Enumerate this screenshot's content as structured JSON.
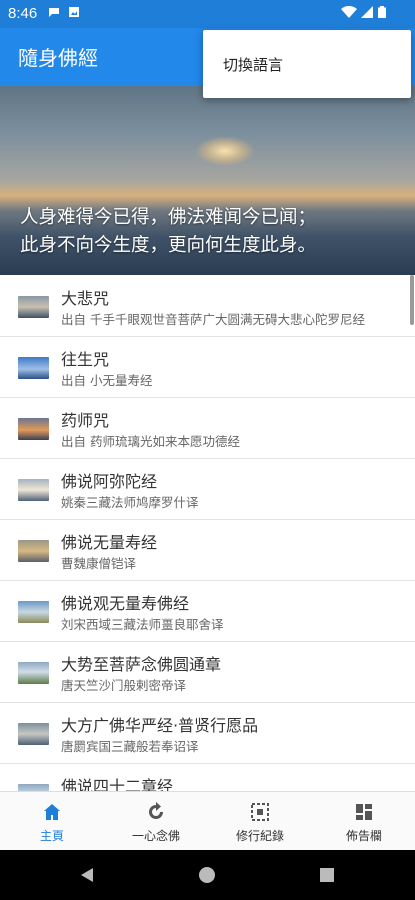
{
  "status_bar": {
    "time": "8:46",
    "icons": [
      "message-icon",
      "image-icon",
      "wifi-icon",
      "signal-icon",
      "battery-icon"
    ]
  },
  "app_bar": {
    "title": "隨身佛經"
  },
  "overflow_menu": {
    "items": [
      "切換語言"
    ]
  },
  "banner": {
    "verse_line1": "人身难得今已得，佛法难闻今已闻；",
    "verse_line2": "此身不向今生度，更向何生度此身。"
  },
  "scripture_list": [
    {
      "title": "大悲咒",
      "subtitle": "出自 千手千眼观世音菩萨广大圆满无碍大悲心陀罗尼经"
    },
    {
      "title": "往生咒",
      "subtitle": "出自 小无量寿经"
    },
    {
      "title": "药师咒",
      "subtitle": "出自 药师琉璃光如来本愿功德经"
    },
    {
      "title": "佛说阿弥陀经",
      "subtitle": "姚秦三藏法师鸠摩罗什译"
    },
    {
      "title": "佛说无量寿经",
      "subtitle": "曹魏康僧铠译"
    },
    {
      "title": "佛说观无量寿佛经",
      "subtitle": "刘宋西域三藏法师畺良耶舍译"
    },
    {
      "title": "大势至菩萨念佛圆通章",
      "subtitle": "唐天竺沙门般剌密帝译"
    },
    {
      "title": "大方广佛华严经·普贤行愿品",
      "subtitle": "唐罽宾国三藏般若奉诏译"
    },
    {
      "title": "佛说四十二章经",
      "subtitle": ""
    }
  ],
  "tabs": [
    {
      "label": "主頁",
      "icon": "home-icon",
      "active": true
    },
    {
      "label": "一心念佛",
      "icon": "refresh-icon",
      "active": false
    },
    {
      "label": "修行紀錄",
      "icon": "record-icon",
      "active": false
    },
    {
      "label": "佈告欄",
      "icon": "dashboard-icon",
      "active": false
    }
  ],
  "colors": {
    "primary": "#2288ea",
    "status_bar": "#1f7fd8",
    "active_tab": "#1f7fd8"
  }
}
